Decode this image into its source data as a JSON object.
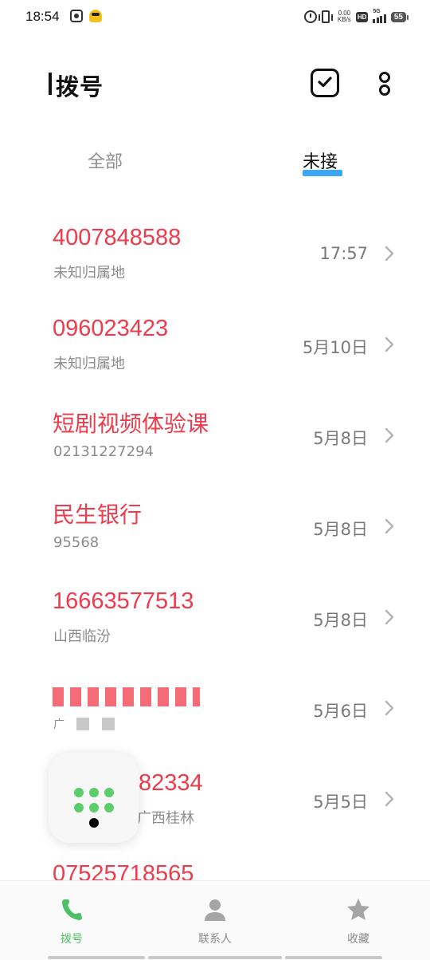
{
  "status_bar": {
    "time": "18:54",
    "network_speed_value": "0.00",
    "network_speed_unit": "KB/s",
    "hd_label": "HD",
    "signal_label": "5G",
    "battery_level": "55"
  },
  "header": {
    "title": "拨号"
  },
  "tabs": [
    {
      "label": "全部",
      "active": false
    },
    {
      "label": "未接",
      "active": true
    }
  ],
  "calls": [
    {
      "name": "4007848588",
      "subtitle": "未知归属地",
      "time": "17:57"
    },
    {
      "name": "096023423",
      "subtitle": "未知归属地",
      "time": "5月10日"
    },
    {
      "name": "短剧视频体验课",
      "subtitle": "02131227294",
      "time": "5月8日"
    },
    {
      "name": "民生银行",
      "subtitle": "95568",
      "time": "5月8日"
    },
    {
      "name": "16663577513",
      "subtitle": "山西临汾",
      "time": "5月8日"
    },
    {
      "name": "",
      "subtitle": "广",
      "time": "5月6日"
    },
    {
      "name": "82334",
      "subtitle": "广西桂林",
      "time": "5月5日"
    },
    {
      "name": "07525718565",
      "subtitle": "",
      "time": ""
    }
  ],
  "bottom_nav": [
    {
      "label": "拨号",
      "icon": "phone-icon",
      "active": true
    },
    {
      "label": "联系人",
      "icon": "person-icon",
      "active": false
    },
    {
      "label": "收藏",
      "icon": "star-icon",
      "active": false
    }
  ],
  "colors": {
    "missed_call": "#ef3b4b",
    "tab_accent": "#3ba7f6",
    "active_nav": "#4cc064",
    "dialpad_dots": "#5bce6b"
  }
}
